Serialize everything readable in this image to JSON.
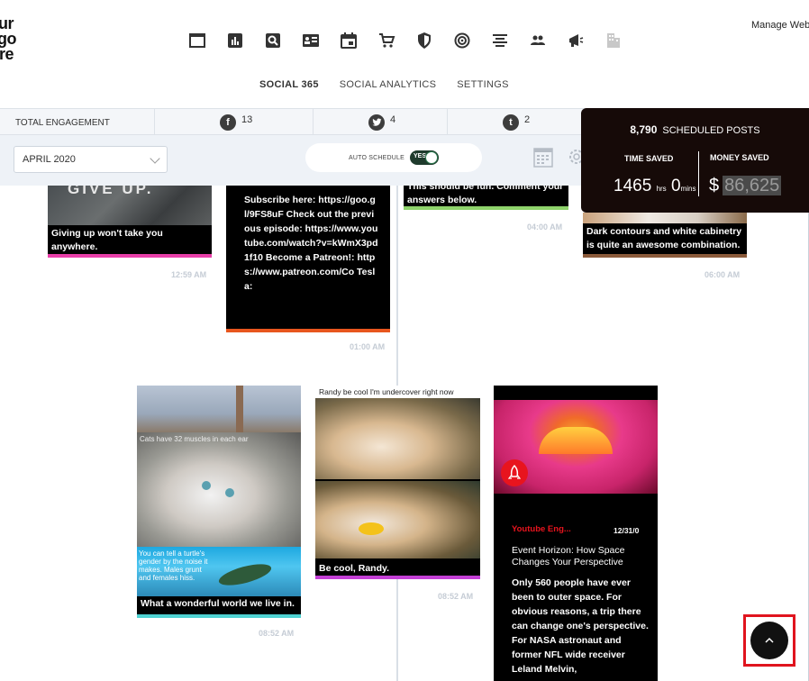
{
  "header": {
    "manage_link": "Manage Web",
    "logo_lines": [
      "ur",
      "go",
      "re"
    ]
  },
  "nav": {
    "tabs": [
      {
        "label": "SOCIAL 365",
        "active": true
      },
      {
        "label": "SOCIAL ANALYTICS",
        "active": false
      },
      {
        "label": "SETTINGS",
        "active": false
      }
    ]
  },
  "engagement": {
    "label": "TOTAL ENGAGEMENT",
    "facebook": "13",
    "twitter": "4",
    "tumblr": "2"
  },
  "controls": {
    "month": "APRIL 2020",
    "auto_schedule_label": "AUTO SCHEDULE",
    "toggle_label": "YES"
  },
  "scheduled": {
    "count": "8,790",
    "label": "SCHEDULED POSTS",
    "time_saved_label": "TIME SAVED",
    "money_saved_label": "MONEY SAVED",
    "hours": "1465",
    "hours_unit": "hrs",
    "mins": "0",
    "mins_unit": "mins",
    "currency": "$",
    "money": "86,625"
  },
  "posts": {
    "p1": {
      "top_text": "GIVE UP.",
      "caption": "Giving up won't take you anywhere.",
      "time": "12:59 AM",
      "bar_color": "#e83ea8"
    },
    "p2": {
      "body": "Subscribe here: https://goo.gl/9FS8uF Check out the previous episode: https://www.youtube.com/watch?v=kWmX3pd1f10 Become a Patreon!: https://www.patreon.com/Co Tesla:",
      "time": "01:00 AM",
      "bar_color": "#e8561e"
    },
    "p3": {
      "caption": "This should be fun. Comment your answers below.",
      "time": "04:00 AM",
      "bar_color": "#8ed36b"
    },
    "p4": {
      "caption": "Dark contours and white cabinetry is quite an awesome combination.",
      "time": "06:00 AM",
      "bar_color": "#8a5a3a"
    },
    "p5": {
      "overlay": "Cats have 32 muscles in each ear",
      "turtle": "You can tell a turtle's gender by the noise it makes. Males grunt and females hiss.",
      "caption": "What a wonderful world we live in.",
      "time": "08:52 AM",
      "bar_color": "#4fd1d1"
    },
    "p6": {
      "header": "Randy be cool I'm undercover right now",
      "caption": "Be cool, Randy.",
      "time": "08:52 AM",
      "bar_color": "#c43fd6"
    },
    "p7": {
      "channel": "Youtube Eng...",
      "date": "12/31/0",
      "title": "Event Horizon: How Space Changes Your Perspective",
      "body": "Only 560 people have ever been to outer space. For obvious reasons, a trip there can change one's perspective. For NASA astronaut and former NFL wide receiver Leland Melvin,"
    }
  }
}
